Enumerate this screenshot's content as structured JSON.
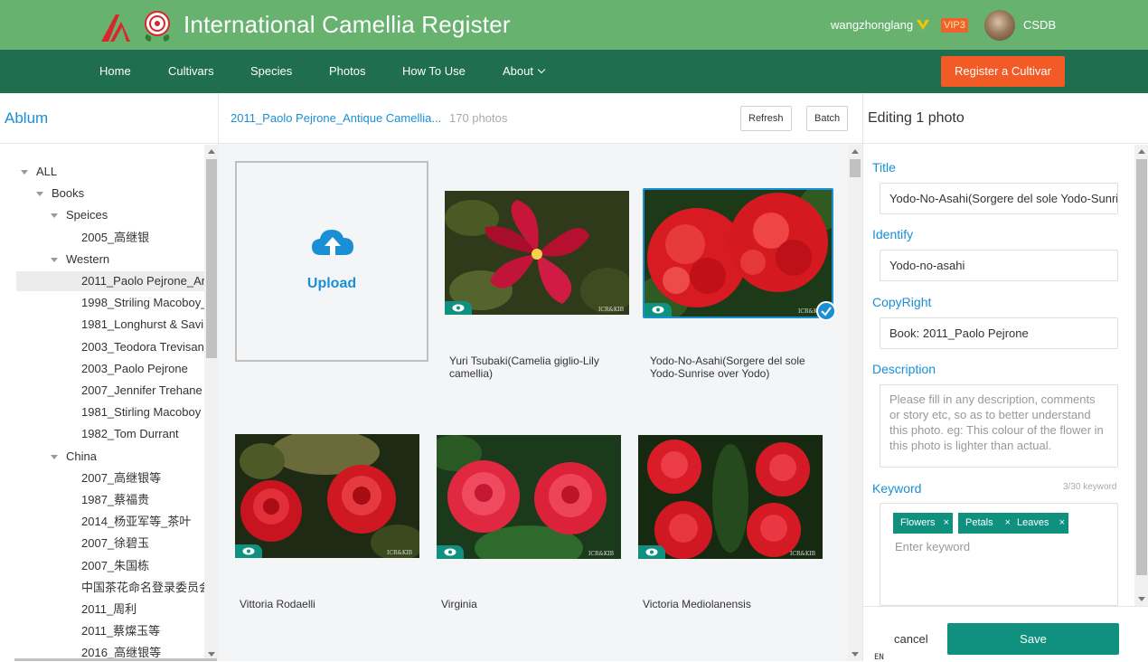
{
  "header": {
    "site_title": "International Camellia Register",
    "user_name": "wangzhonglang",
    "vip_badge": "VIP3",
    "database": "CSDB"
  },
  "nav": {
    "items": [
      "Home",
      "Cultivars",
      "Species",
      "Photos",
      "How To Use",
      "About"
    ],
    "register_label": "Register a Cultivar"
  },
  "left": {
    "title": "Ablum",
    "tree": [
      {
        "label": "ALL",
        "level": 0,
        "expanded": true
      },
      {
        "label": "Books",
        "level": 1,
        "expanded": true
      },
      {
        "label": "Speices",
        "level": 2,
        "expanded": true
      },
      {
        "label": "2005_高继银",
        "level": 3
      },
      {
        "label": "Western",
        "level": 2,
        "expanded": true
      },
      {
        "label": "2011_Paolo Pejrone_Ar",
        "level": 3,
        "selected": true
      },
      {
        "label": "1998_Striling Macoboy_",
        "level": 3
      },
      {
        "label": "1981_Longhurst & Savi",
        "level": 3
      },
      {
        "label": "2003_Teodora Trevisan",
        "level": 3
      },
      {
        "label": "2003_Paolo Pejrone",
        "level": 3
      },
      {
        "label": "2007_Jennifer Trehane",
        "level": 3
      },
      {
        "label": "1981_Stirling Macoboy",
        "level": 3
      },
      {
        "label": "1982_Tom Durrant",
        "level": 3
      },
      {
        "label": "China",
        "level": 2,
        "expanded": true
      },
      {
        "label": "2007_高继银等",
        "level": 3
      },
      {
        "label": "1987_蔡福贵",
        "level": 3
      },
      {
        "label": "2014_杨亚军等_茶叶",
        "level": 3
      },
      {
        "label": "2007_徐碧玉",
        "level": 3
      },
      {
        "label": "2007_朱国栋",
        "level": 3
      },
      {
        "label": "中国茶花命名登录委员会",
        "level": 3
      },
      {
        "label": "2011_周利",
        "level": 3
      },
      {
        "label": "2011_蔡燦玉等",
        "level": 3
      },
      {
        "label": "2016_高继银等",
        "level": 3
      }
    ]
  },
  "center": {
    "album_path": "2011_Paolo Pejrone_Antique Camellia...",
    "photo_count": "170 photos",
    "refresh_label": "Refresh",
    "batch_label": "Batch",
    "upload_label": "Upload",
    "photos": [
      {
        "caption": "Yuri Tsubaki(Camelia giglio-Lily camellia)"
      },
      {
        "caption": "Yodo-No-Asahi(Sorgere del sole Yodo-Sunrise over Yodo)",
        "selected": true
      },
      {
        "caption": "Vittoria Rodaelli"
      },
      {
        "caption": "Virginia"
      },
      {
        "caption": "Victoria Mediolanensis"
      }
    ],
    "watermark": "ICR&KIB"
  },
  "right": {
    "title": "Editing 1 photo",
    "title_label": "Title",
    "title_value": "Yodo-No-Asahi(Sorgere del sole Yodo-Sunri",
    "identify_label": "Identify",
    "identify_value": "Yodo-no-asahi",
    "copyright_label": "CopyRight",
    "copyright_value": "Book: 2011_Paolo Pejrone",
    "description_label": "Description",
    "description_placeholder": "Please fill in any description, comments or story etc, so as to better understand this photo. eg: This colour of the flower in this photo is lighter than actual.",
    "keyword_label": "Keyword",
    "keyword_count": "3/30 keyword",
    "keywords": [
      "Flowers",
      "Petals",
      "Leaves"
    ],
    "keyword_placeholder": "Enter keyword",
    "cancel_label": "cancel",
    "save_label": "Save",
    "lang": "EN"
  },
  "colors": {
    "header_green": "#67b26f",
    "nav_green": "#1e6e4f",
    "accent_blue": "#1a8fd6",
    "teal": "#10917f",
    "orange": "#f25a26"
  }
}
